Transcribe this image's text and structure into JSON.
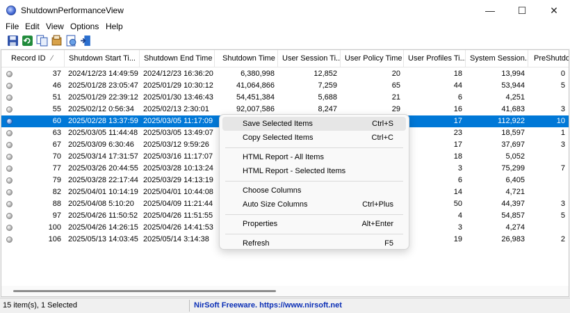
{
  "window": {
    "title": "ShutdownPerformanceView",
    "minimize": "—",
    "maximize": "☐",
    "close": "✕"
  },
  "menu": [
    "File",
    "Edit",
    "View",
    "Options",
    "Help"
  ],
  "toolbar_icons": [
    "save-icon",
    "refresh-icon",
    "copy-icon",
    "properties-icon",
    "html-report-icon",
    "exit-icon"
  ],
  "columns": [
    "Record ID",
    "Shutdown Start Ti...",
    "Shutdown End Time",
    "Shutdown Time",
    "User Session Ti...",
    "User Policy Time",
    "User Profiles Ti...",
    "System Session...",
    "PreShutdo"
  ],
  "sort_indicator": "∕",
  "rows": [
    {
      "id": "37",
      "start": "2024/12/23 14:49:59",
      "end": "2024/12/23 16:36:20",
      "shutdown": "6,380,998",
      "session": "12,852",
      "policy": "20",
      "profiles": "18",
      "system": "13,994",
      "pre": "0"
    },
    {
      "id": "46",
      "start": "2025/01/28 23:05:47",
      "end": "2025/01/29 10:30:12",
      "shutdown": "41,064,866",
      "session": "7,259",
      "policy": "65",
      "profiles": "44",
      "system": "53,944",
      "pre": "5"
    },
    {
      "id": "51",
      "start": "2025/01/29 22:39:12",
      "end": "2025/01/30 13:46:43",
      "shutdown": "54,451,384",
      "session": "5,688",
      "policy": "21",
      "profiles": "6",
      "system": "4,251",
      "pre": ""
    },
    {
      "id": "55",
      "start": "2025/02/12 0:56:34",
      "end": "2025/02/13 2:30:01",
      "shutdown": "92,007,586",
      "session": "8,247",
      "policy": "29",
      "profiles": "16",
      "system": "41,683",
      "pre": "3"
    },
    {
      "id": "60",
      "start": "2025/02/28 13:37:59",
      "end": "2025/03/05 11:17:09",
      "shutdown": "",
      "session": "",
      "policy": "",
      "profiles": "17",
      "system": "112,922",
      "pre": "10",
      "selected": true
    },
    {
      "id": "63",
      "start": "2025/03/05 11:44:48",
      "end": "2025/03/05 13:49:07",
      "shutdown": "",
      "session": "",
      "policy": "",
      "profiles": "23",
      "system": "18,597",
      "pre": "1"
    },
    {
      "id": "67",
      "start": "2025/03/09 6:30:46",
      "end": "2025/03/12 9:59:26",
      "shutdown": "",
      "session": "",
      "policy": "",
      "profiles": "17",
      "system": "37,697",
      "pre": "3"
    },
    {
      "id": "70",
      "start": "2025/03/14 17:31:57",
      "end": "2025/03/16 11:17:07",
      "shutdown": "",
      "session": "",
      "policy": "",
      "profiles": "18",
      "system": "5,052",
      "pre": ""
    },
    {
      "id": "77",
      "start": "2025/03/26 20:44:55",
      "end": "2025/03/28 10:13:24",
      "shutdown": "",
      "session": "",
      "policy": "",
      "profiles": "3",
      "system": "75,299",
      "pre": "7"
    },
    {
      "id": "79",
      "start": "2025/03/28 22:17:44",
      "end": "2025/03/29 14:13:19",
      "shutdown": "",
      "session": "",
      "policy": "",
      "profiles": "6",
      "system": "6,405",
      "pre": ""
    },
    {
      "id": "82",
      "start": "2025/04/01 10:14:19",
      "end": "2025/04/01 10:44:08",
      "shutdown": "",
      "session": "",
      "policy": "",
      "profiles": "14",
      "system": "4,721",
      "pre": ""
    },
    {
      "id": "88",
      "start": "2025/04/08 5:10:20",
      "end": "2025/04/09 11:21:44",
      "shutdown": "",
      "session": "",
      "policy": "",
      "profiles": "50",
      "system": "44,397",
      "pre": "3"
    },
    {
      "id": "97",
      "start": "2025/04/26 11:50:52",
      "end": "2025/04/26 11:51:55",
      "shutdown": "",
      "session": "",
      "policy": "",
      "profiles": "4",
      "system": "54,857",
      "pre": "5"
    },
    {
      "id": "100",
      "start": "2025/04/26 14:26:15",
      "end": "2025/04/26 14:41:53",
      "shutdown": "",
      "session": "",
      "policy": "",
      "profiles": "3",
      "system": "4,274",
      "pre": ""
    },
    {
      "id": "106",
      "start": "2025/05/13 14:03:45",
      "end": "2025/05/14 3:14:38",
      "shutdown": "",
      "session": "",
      "policy": "",
      "profiles": "19",
      "system": "26,983",
      "pre": "2"
    }
  ],
  "context_menu": {
    "items": [
      {
        "label": "Save Selected Items",
        "shortcut": "Ctrl+S",
        "hover": true
      },
      {
        "label": "Copy Selected Items",
        "shortcut": "Ctrl+C"
      },
      {
        "sep": true
      },
      {
        "label": "HTML Report - All Items",
        "shortcut": ""
      },
      {
        "label": "HTML Report - Selected Items",
        "shortcut": ""
      },
      {
        "sep": true
      },
      {
        "label": "Choose Columns",
        "shortcut": ""
      },
      {
        "label": "Auto Size Columns",
        "shortcut": "Ctrl+Plus"
      },
      {
        "sep": true
      },
      {
        "label": "Properties",
        "shortcut": "Alt+Enter"
      },
      {
        "sep": true
      },
      {
        "label": "Refresh",
        "shortcut": "F5"
      }
    ]
  },
  "status": {
    "count_text": "15 item(s), 1 Selected",
    "link_text": "NirSoft Freeware. https://www.nirsoft.net"
  }
}
